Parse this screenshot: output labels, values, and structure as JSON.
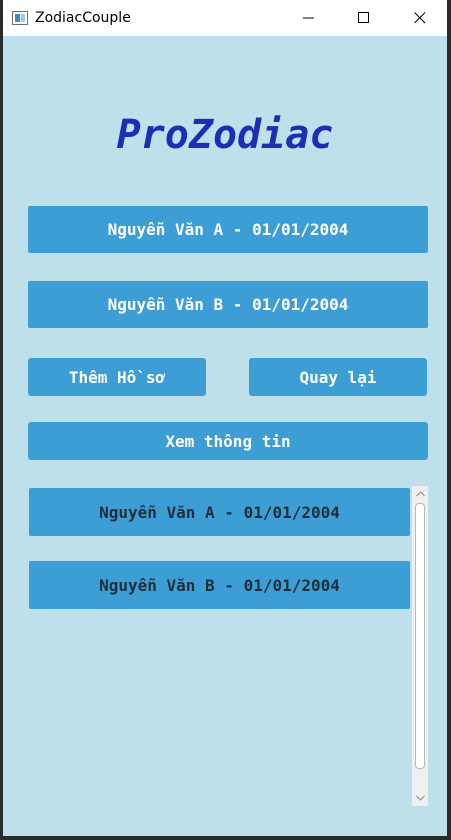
{
  "window": {
    "title": "ZodiacCouple"
  },
  "header": {
    "title": "ProZodiac"
  },
  "profiles": {
    "first": "Nguyễn Văn A - 01/01/2004",
    "second": "Nguyễn Văn B - 01/01/2004"
  },
  "actions": {
    "add_profile": "Thêm Hồ sơ",
    "back": "Quay lại",
    "view_info": "Xem thông tin"
  },
  "list": {
    "items": [
      "Nguyễn Văn A - 01/01/2004",
      "Nguyễn Văn B - 01/01/2004"
    ]
  },
  "colors": {
    "background": "#bde0eb",
    "button": "#3d9ed6",
    "heading": "#1a2fb5"
  }
}
